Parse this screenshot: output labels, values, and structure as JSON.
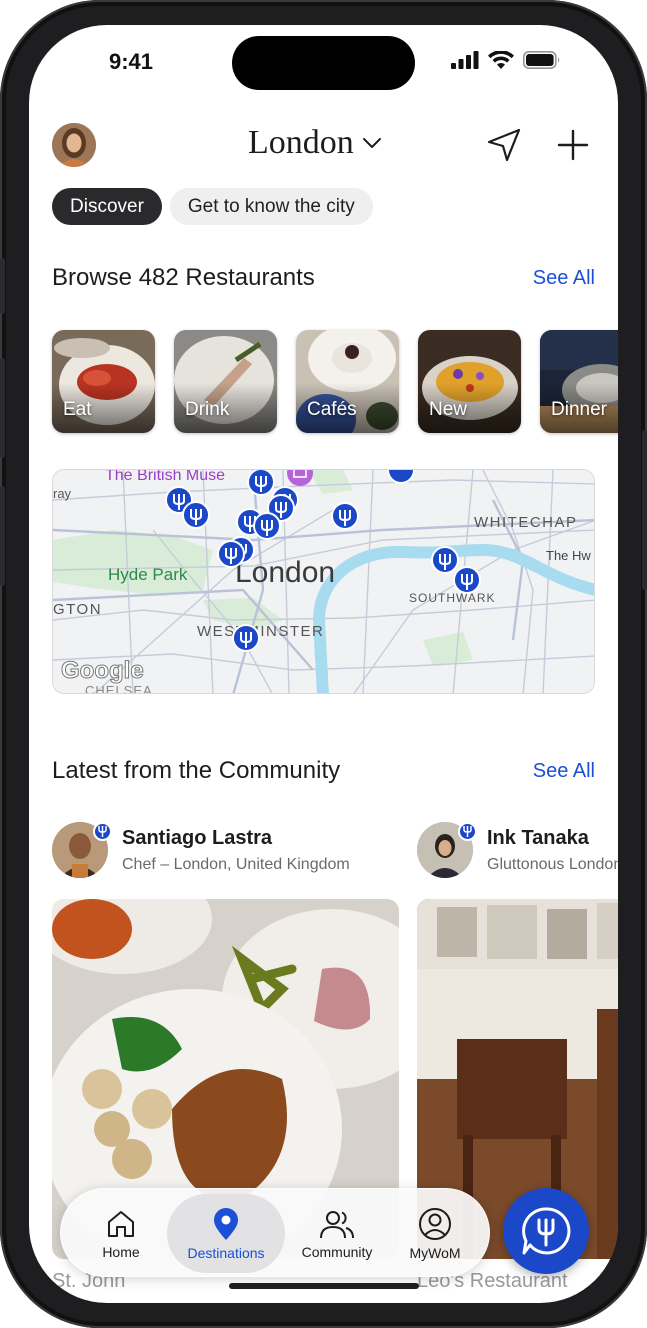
{
  "status_bar": {
    "time": "9:41"
  },
  "header": {
    "city": "London",
    "icons": [
      "avatar",
      "chevron-down-icon",
      "location-arrow-icon",
      "plus-icon"
    ]
  },
  "chips": [
    {
      "label": "Discover",
      "active": true
    },
    {
      "label": "Get to know the city",
      "active": false
    }
  ],
  "browse": {
    "title": "Browse 482 Restaurants",
    "see_all": "See All",
    "categories": [
      {
        "label": "Eat"
      },
      {
        "label": "Drink"
      },
      {
        "label": "Cafés"
      },
      {
        "label": "New"
      },
      {
        "label": "Dinner"
      }
    ]
  },
  "map": {
    "center_label": "London",
    "labels": {
      "museum": "The British Muse",
      "park": "Hyde Park",
      "whitechapel": "WHITECHAP",
      "southwark": "SOUTHWARK",
      "westminster": "WESTMINSTER",
      "kensington": "GTON",
      "the_hw": "The Hw",
      "chelsea": "CHELSEA",
      "ray": "ray",
      "google": "Google"
    }
  },
  "community": {
    "title": "Latest from the Community",
    "see_all": "See All",
    "posts": [
      {
        "name": "Santiago Lastra",
        "subtitle": "Chef – London, United Kingdom",
        "caption": "St. John"
      },
      {
        "name": "Ink Tanaka",
        "subtitle": "Gluttonous London",
        "caption": "Leo's Restaurant"
      }
    ]
  },
  "tabbar": {
    "tabs": [
      {
        "label": "Home",
        "icon": "home-icon",
        "active": false
      },
      {
        "label": "Destinations",
        "icon": "location-pin-icon",
        "active": true
      },
      {
        "label": "Community",
        "icon": "people-icon",
        "active": false
      },
      {
        "label": "MyWoM",
        "icon": "user-circle-icon",
        "active": false
      }
    ],
    "fab_icon": "fork-chat-icon"
  },
  "colors": {
    "accent": "#1a4fd6",
    "pin": "#1b47c9",
    "chip_active": "#2a2a2c"
  }
}
